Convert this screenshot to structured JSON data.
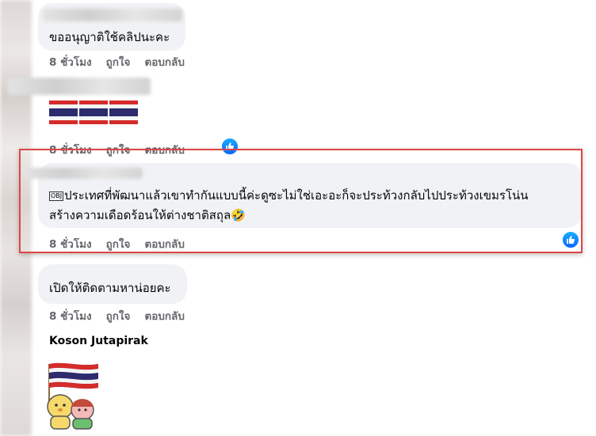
{
  "comments": [
    {
      "text": "ขออนุญาติใช้คลิปนะคะ",
      "time": "8 ชั่วโมง",
      "like": "ถูกใจ",
      "reply": "ตอบกลับ"
    },
    {
      "text": "🇹🇭🇹🇭🇹🇭",
      "time": "8 ชั่วโมง",
      "like": "ถูกใจ",
      "reply": "ตอบกลับ"
    },
    {
      "badge": "OBJ",
      "line1": "ประเทศที่พัฒนาแล้วเขาทำกันแบบนี้ค่ะดูซะไม่ใช่เอะอะก็จะประท้วงกลับไปประท้วงเขมรโน่น",
      "line2": "สร้างความเดือดร้อนให้ต่างชาติสถุล🤣",
      "time": "8 ชั่วโมง",
      "like": "ถูกใจ",
      "reply": "ตอบกลับ"
    },
    {
      "text": "เปิดให้ติดตามหาน่อยคะ",
      "time": "8 ชั่วโมง",
      "like": "ถูกใจ",
      "reply": "ตอบกลับ"
    },
    {
      "author": "Koson Jutapirak"
    }
  ],
  "colors": {
    "highlight": "#e04545",
    "bubble": "#f0f2f5",
    "like_blue": "#0866ff",
    "meta": "#65676b"
  },
  "icons": [
    "thumbs-up-icon",
    "thai-flag-sticker"
  ]
}
